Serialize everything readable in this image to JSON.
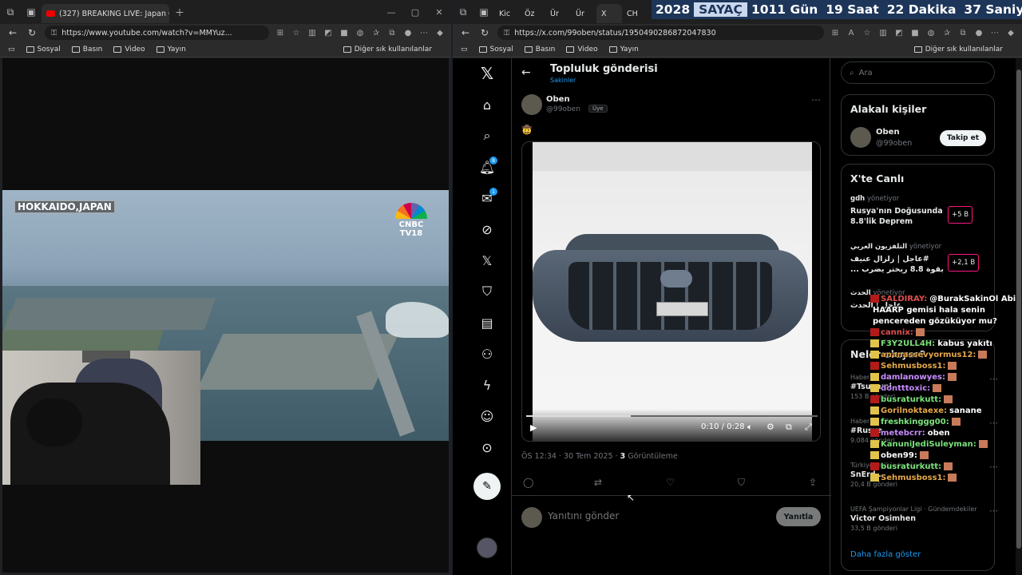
{
  "left_window": {
    "tab_title": "(327) BREAKING LIVE: Japan Coa:",
    "url": "https://www.youtube.com/watch?v=MMYuz...",
    "bookmarks": [
      "Sosyal",
      "Basın",
      "Video",
      "Yayın"
    ],
    "bookmarks_right": "Diğer sık kullanılanlar",
    "video_label": "HOKKAIDO,JAPAN",
    "channel_logo": "CNBC TV18"
  },
  "right_window": {
    "tabs": [
      "Kic",
      "Öz",
      "Ür",
      "Ür",
      "X",
      "CH"
    ],
    "url": "https://x.com/99oben/status/1950490286872047830",
    "bookmarks": [
      "Sosyal",
      "Basın",
      "Video",
      "Yayın"
    ],
    "bookmarks_right": "Diğer sık kullanılanlar"
  },
  "counter": {
    "year": "2028",
    "label": "SAYAÇ",
    "days": "1011 Gün",
    "hours": "19 Saat",
    "minutes": "22 Dakika",
    "seconds": "37 Saniye"
  },
  "x": {
    "nav_badges": {
      "notifications": "8",
      "messages": "1"
    },
    "column_header": {
      "title": "Topluluk gönderisi",
      "subtitle": "Sakinler"
    },
    "post": {
      "author_name": "Oben",
      "author_handle": "@99oben",
      "role": "Üye",
      "emoji": "🤠",
      "time": "ÖS 12:34 · 30 Tem 2025 · ",
      "views_count": "3",
      "views_label": " Görüntüleme"
    },
    "video": {
      "time": "0:10 / 0:28",
      "progress": 0.36
    },
    "reply": {
      "placeholder": "Yanıtını gönder",
      "button": "Yanıtla"
    },
    "search": {
      "placeholder": "Ara"
    },
    "related": {
      "title": "Alakalı kişiler",
      "name": "Oben",
      "handle": "@99oben",
      "follow": "Takip et"
    },
    "live": {
      "title": "X'te Canlı",
      "items": [
        {
          "host": "gdh",
          "role": "yönetiyor",
          "text": "Rusya'nın Doğusunda 8.8'lik Deprem",
          "count": "+5 B"
        },
        {
          "host": "التلفزيون العربي",
          "role": "yönetiyor",
          "text": "#عاجل | زلزال عنيف بقوة 8.8 ريختر يضرب ...",
          "count": "+2,1 B"
        },
        {
          "host": "الحدث",
          "role": "yönetiyor",
          "text": "عاجل | الحدث",
          "count": ""
        }
      ]
    },
    "trends": {
      "title": "Neler oluyor?",
      "items": [
        {
          "context": "Haberler · Gündemdekiler",
          "name": "#Tsunami",
          "count": "153 B gönderi"
        },
        {
          "context": "Haberler · Gündemdekiler",
          "name": "#Rusya",
          "count": "9.084 gönderi"
        },
        {
          "context": "Türkiye tarihinde gündemde",
          "name": "SnErd...",
          "count": "20,4 B gönderi"
        },
        {
          "context": "UEFA Şampiyonlar Ligi · Gündemdekiler",
          "name": "Victor Osimhen",
          "count": "33,5 B gönderi"
        }
      ],
      "show_more": "Daha fazla göster"
    }
  },
  "chat": [
    {
      "user": "SALDIRAY:",
      "color": "#e05050",
      "msg": "@BurakSakinOl Abi"
    },
    {
      "user": "",
      "color": "#ffffff",
      "msg": "HAARP gemisi hala senin"
    },
    {
      "user": "",
      "color": "#ffffff",
      "msg": "pencereden gözüküyor mu?"
    },
    {
      "user": "cannix:",
      "color": "#e05050",
      "msg": ""
    },
    {
      "user": "F3Y2ULL4H:",
      "color": "#7be27b",
      "msg": "kabus yakıtı"
    },
    {
      "user": "ananassevyormus12:",
      "color": "#e6a84a",
      "msg": ""
    },
    {
      "user": "Sehmusboss1:",
      "color": "#e6a84a",
      "msg": ""
    },
    {
      "user": "damlanowyes:",
      "color": "#c78bff",
      "msg": ""
    },
    {
      "user": "dontttoxic:",
      "color": "#c78bff",
      "msg": ""
    },
    {
      "user": "busraturkutt:",
      "color": "#7be27b",
      "msg": ""
    },
    {
      "user": "Gorilnoktaexe:",
      "color": "#e6a84a",
      "msg": "sanane"
    },
    {
      "user": "freshkinggg00:",
      "color": "#7be27b",
      "msg": ""
    },
    {
      "user": "metebcrr:",
      "color": "#c78bff",
      "msg": "oben"
    },
    {
      "user": "KanuniJediSuleyman:",
      "color": "#7be27b",
      "msg": ""
    },
    {
      "user": "oben99:",
      "color": "#ffffff",
      "msg": ""
    },
    {
      "user": "busraturkutt:",
      "color": "#7be27b",
      "msg": ""
    },
    {
      "user": "Sehmusboss1:",
      "color": "#e6a84a",
      "msg": ""
    }
  ],
  "colors": {
    "x_accent": "#1d9bf0",
    "live_border": "#f91880",
    "counter_bg": "#1d3559"
  }
}
